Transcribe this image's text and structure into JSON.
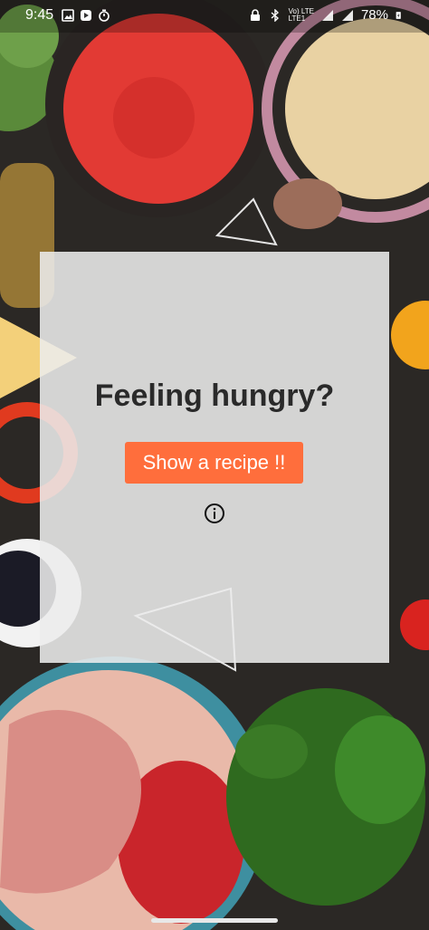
{
  "status_bar": {
    "time": "9:45",
    "network": "Vo) LTE\nLTE1",
    "battery": "78%"
  },
  "card": {
    "headline": "Feeling hungry?",
    "button_label": "Show a recipe !!"
  },
  "icons": {
    "info": "info-icon"
  },
  "colors": {
    "button": "#ff6e3c",
    "card": "#ececec",
    "headline": "#2a2a2a"
  }
}
